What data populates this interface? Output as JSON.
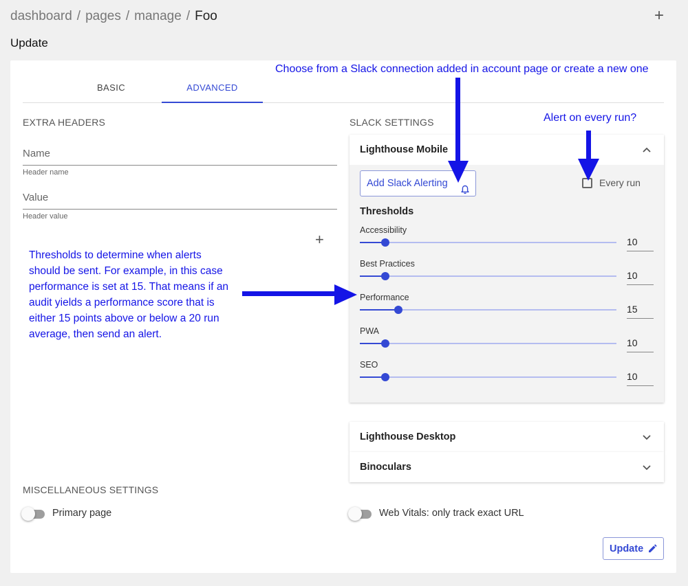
{
  "breadcrumb": {
    "items": [
      "dashboard",
      "pages",
      "manage"
    ],
    "current": "Foo",
    "separator": "/"
  },
  "header": {
    "add_icon": "plus-icon",
    "add_glyph": "+"
  },
  "page_title": "Update",
  "tabs": [
    {
      "label": "BASIC",
      "active": false
    },
    {
      "label": "ADVANCED",
      "active": true
    }
  ],
  "extra_headers": {
    "title": "EXTRA HEADERS",
    "name_placeholder": "Name",
    "name_help": "Header name",
    "value_placeholder": "Value",
    "value_help": "Header value",
    "add_icon": "plus-icon",
    "add_glyph": "+"
  },
  "slack_settings": {
    "title": "SLACK SETTINGS",
    "panels": [
      {
        "label": "Lighthouse Mobile",
        "expanded": true
      },
      {
        "label": "Lighthouse Desktop",
        "expanded": false
      },
      {
        "label": "Binoculars",
        "expanded": false
      }
    ],
    "add_button_label": "Add Slack Alerting",
    "add_button_icon": "bell-icon",
    "every_run_label": "Every run",
    "every_run_checked": false,
    "thresholds_title": "Thresholds",
    "slider_max": 100,
    "thresholds": [
      {
        "label": "Accessibility",
        "value": "10"
      },
      {
        "label": "Best Practices",
        "value": "10"
      },
      {
        "label": "Performance",
        "value": "15"
      },
      {
        "label": "PWA",
        "value": "10"
      },
      {
        "label": "SEO",
        "value": "10"
      }
    ]
  },
  "misc": {
    "title": "MISCELLANEOUS SETTINGS",
    "primary_page_label": "Primary page",
    "primary_page_on": false,
    "web_vitals_label": "Web Vitals: only track exact URL",
    "web_vitals_on": false
  },
  "update_button": {
    "label": "Update",
    "icon": "pencil-icon"
  },
  "annotations": {
    "slack_connection": "Choose from a Slack connection added in account page or create a new one",
    "every_run": "Alert on every run?",
    "thresholds": "Thresholds to determine when alerts should be sent. For example, in this case performance is set at 15. That means if an audit yields a performance score that is either 15 points above or below a 20 run average, then send an alert."
  },
  "colors": {
    "accent": "#3449d4",
    "annotation": "#1414e6",
    "background": "#f0f0f0"
  }
}
